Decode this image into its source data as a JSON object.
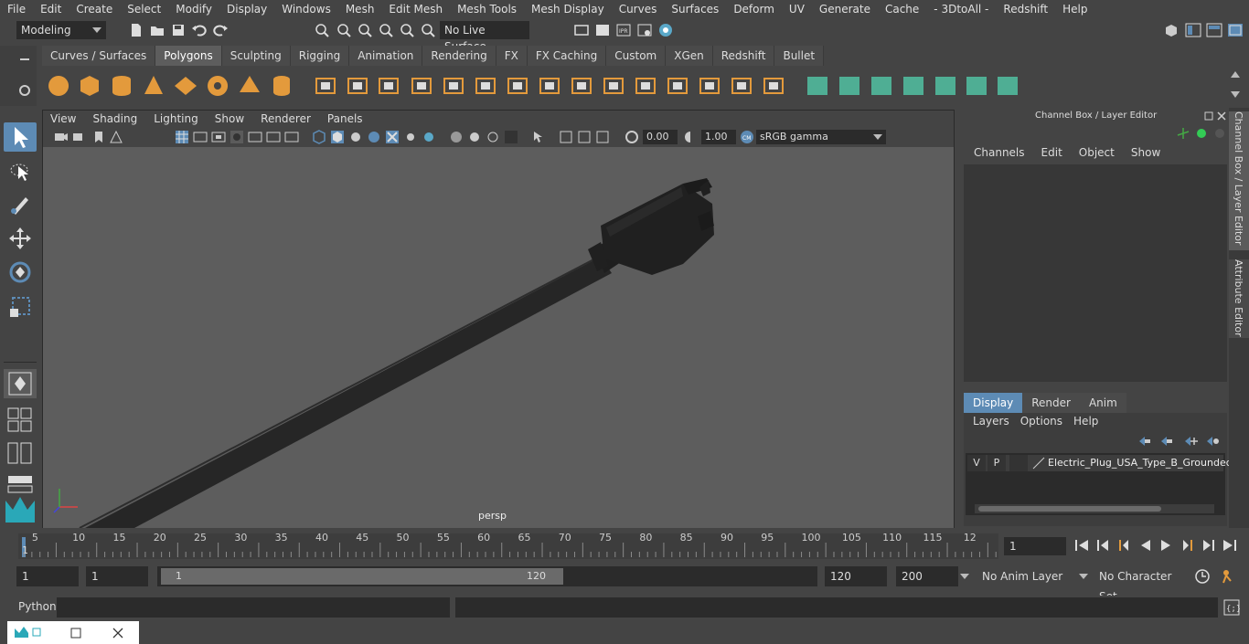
{
  "menubar": [
    "File",
    "Edit",
    "Create",
    "Select",
    "Modify",
    "Display",
    "Windows",
    "Mesh",
    "Edit Mesh",
    "Mesh Tools",
    "Mesh Display",
    "Curves",
    "Surfaces",
    "Deform",
    "UV",
    "Generate",
    "Cache",
    "- 3DtoAll -",
    "Redshift",
    "Help"
  ],
  "status": {
    "mode": "Modeling",
    "live_surface": "No Live Surface"
  },
  "shelf_tabs": [
    "Curves / Surfaces",
    "Polygons",
    "Sculpting",
    "Rigging",
    "Animation",
    "Rendering",
    "FX",
    "FX Caching",
    "Custom",
    "XGen",
    "Redshift",
    "Bullet"
  ],
  "shelf_active": "Polygons",
  "viewport": {
    "menus": [
      "View",
      "Shading",
      "Lighting",
      "Show",
      "Renderer",
      "Panels"
    ],
    "exposure": "0.00",
    "gamma": "1.00",
    "color_space": "sRGB gamma",
    "camera_label": "persp"
  },
  "channel_box": {
    "title": "Channel Box / Layer Editor",
    "menus": [
      "Channels",
      "Edit",
      "Object",
      "Show"
    ]
  },
  "layer_editor": {
    "tabs": [
      "Display",
      "Render",
      "Anim"
    ],
    "active_tab": "Display",
    "menus": [
      "Layers",
      "Options",
      "Help"
    ],
    "layer": {
      "v": "V",
      "p": "P",
      "name": "Electric_Plug_USA_Type_B_Grounded"
    }
  },
  "side_tabs": [
    "Channel Box / Layer Editor",
    "Attribute Editor"
  ],
  "timeline": {
    "ticks": [
      "5",
      "10",
      "15",
      "20",
      "25",
      "30",
      "35",
      "40",
      "45",
      "50",
      "55",
      "60",
      "65",
      "70",
      "75",
      "80",
      "85",
      "90",
      "95",
      "100",
      "105",
      "110",
      "115",
      "12"
    ],
    "start_marker": "1",
    "current_frame": "1"
  },
  "range": {
    "start": "1",
    "start2": "1",
    "slider_start": "1",
    "slider_end": "120",
    "end": "120",
    "end2": "200",
    "anim_layer": "No Anim Layer",
    "char_set": "No Character Set"
  },
  "cmdline": {
    "label": "Python"
  },
  "colors": {
    "accent": "#5d8bb5",
    "shelf_orange": "#e39a3c",
    "shelf_teal": "#4fae94",
    "bg": "#444444",
    "viewport_bg": "#5d5d5d"
  }
}
